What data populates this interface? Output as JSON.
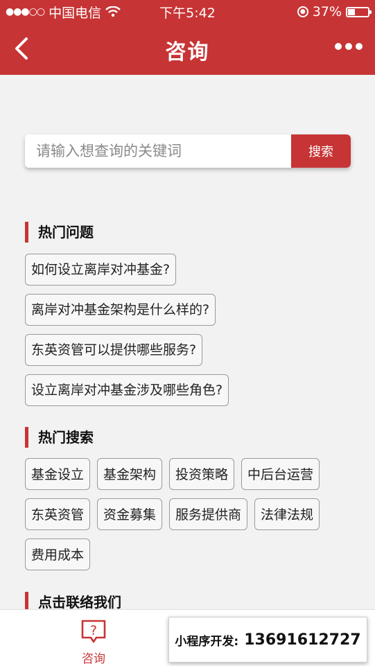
{
  "status_bar": {
    "signal": "●●●○○",
    "carrier": "中国电信",
    "time": "下午5:42",
    "battery_percent": "37%",
    "battery_level": 0.37
  },
  "nav": {
    "title": "咨询"
  },
  "search": {
    "placeholder": "请输入想查询的关键词",
    "value": "",
    "button_label": "搜索"
  },
  "hot_questions": {
    "title": "热门问题",
    "items": [
      "如何设立离岸对冲基金?",
      "离岸对冲基金架构是什么样的?",
      "东英资管可以提供哪些服务?",
      "设立离岸对冲基金涉及哪些角色?"
    ]
  },
  "hot_searches": {
    "title": "热门搜索",
    "tags": [
      "基金设立",
      "基金架构",
      "投资策略",
      "中后台运营",
      "东英资管",
      "资金募集",
      "服务提供商",
      "法律法规",
      "费用成本"
    ]
  },
  "contact": {
    "title": "点击联络我们"
  },
  "tab_bar": {
    "consult_label": "咨询"
  },
  "promo": {
    "label": "小程序开发:",
    "phone": "13691612727"
  },
  "colors": {
    "brand": "#c73435",
    "background": "#f2f2f2"
  }
}
